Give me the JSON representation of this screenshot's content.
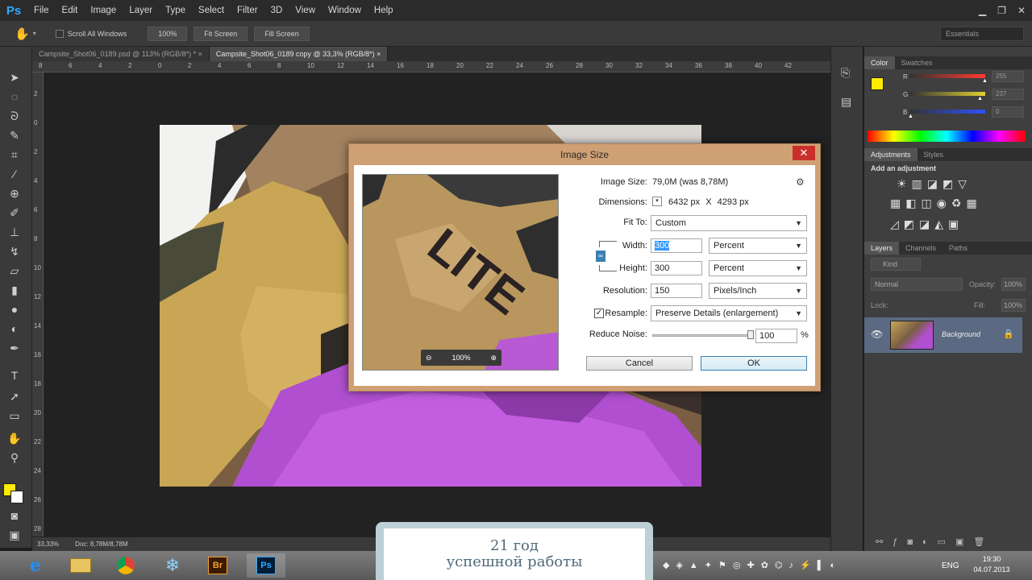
{
  "app": {
    "logo": "Ps",
    "menu": [
      "File",
      "Edit",
      "Image",
      "Layer",
      "Type",
      "Select",
      "Filter",
      "3D",
      "View",
      "Window",
      "Help"
    ]
  },
  "options_bar": {
    "scroll_all_windows": "Scroll All Windows",
    "buttons": [
      "100%",
      "Fit Screen",
      "Fill Screen"
    ],
    "workspace": "Essentials"
  },
  "tabs": [
    {
      "label": "Campsite_Shot06_0189.psd @ 113% (RGB/8*) *",
      "active": false
    },
    {
      "label": "Campsite_Shot06_0189 copy @ 33,3% (RGB/8*)",
      "active": true
    }
  ],
  "ruler": {
    "top_ticks": [
      "8",
      "6",
      "4",
      "2",
      "0",
      "2",
      "4",
      "6",
      "8",
      "10",
      "12",
      "14",
      "16",
      "18",
      "20",
      "22",
      "24",
      "26",
      "28",
      "30",
      "32",
      "34",
      "36",
      "38",
      "40",
      "42"
    ],
    "left_ticks": [
      "2",
      "0",
      "2",
      "4",
      "6",
      "8",
      "10",
      "12",
      "14",
      "16",
      "18",
      "20",
      "22",
      "24",
      "26",
      "28"
    ]
  },
  "status": {
    "zoom": "33,33%",
    "doc": "Doc: 8,78M/8,78M"
  },
  "dialog": {
    "title": "Image Size",
    "image_size_label": "Image Size:",
    "image_size_value": "79,0M (was 8,78M)",
    "dimensions_label": "Dimensions:",
    "dimensions_w": "6432 px",
    "dimensions_x": "X",
    "dimensions_h": "4293 px",
    "fit_to_label": "Fit To:",
    "fit_to_value": "Custom",
    "width_label": "Width:",
    "width_value": "300",
    "width_unit": "Percent",
    "height_label": "Height:",
    "height_value": "300",
    "height_unit": "Percent",
    "resolution_label": "Resolution:",
    "resolution_value": "150",
    "resolution_unit": "Pixels/Inch",
    "resample_label": "Resample:",
    "resample_value": "Preserve Details (enlargement)",
    "reduce_noise_label": "Reduce Noise:",
    "reduce_noise_value": "100",
    "reduce_noise_unit": "%",
    "reduce_noise_level": 1.0,
    "preview_zoom": "100%",
    "preview_text": "LITE",
    "cancel": "Cancel",
    "ok": "OK"
  },
  "panels": {
    "color_tabs": [
      "Color",
      "Swatches"
    ],
    "channels": [
      {
        "name": "R",
        "value": "255",
        "color": "#ff3b30",
        "level": 1.0
      },
      {
        "name": "G",
        "value": "237",
        "color": "#e0d030",
        "level": 0.93
      },
      {
        "name": "B",
        "value": "0",
        "color": "#3050ff",
        "level": 0.0
      }
    ],
    "foreground": "#ffed00",
    "adjustments_tabs": [
      "Adjustments",
      "Styles"
    ],
    "add_adjustment": "Add an adjustment",
    "layers_tabs": [
      "Layers",
      "Channels",
      "Paths"
    ],
    "kind": "Kind",
    "blend_mode": "Normal",
    "opacity_label": "Opacity:",
    "opacity_value": "100%",
    "lock_label": "Lock:",
    "fill_label": "Fill:",
    "fill_value": "100%",
    "layer_name": "Background"
  },
  "taskbar": {
    "apps": [
      "ie-icon",
      "explorer-icon",
      "chrome-icon",
      "snowflake-icon",
      "bridge-icon",
      "photoshop-icon"
    ],
    "bridge_label": "Br",
    "ps_label": "Ps",
    "lang": "ENG",
    "time": "19:30",
    "date": "04.07.2013"
  },
  "banner": {
    "line1": "21 год",
    "line2": "успешной работы"
  }
}
